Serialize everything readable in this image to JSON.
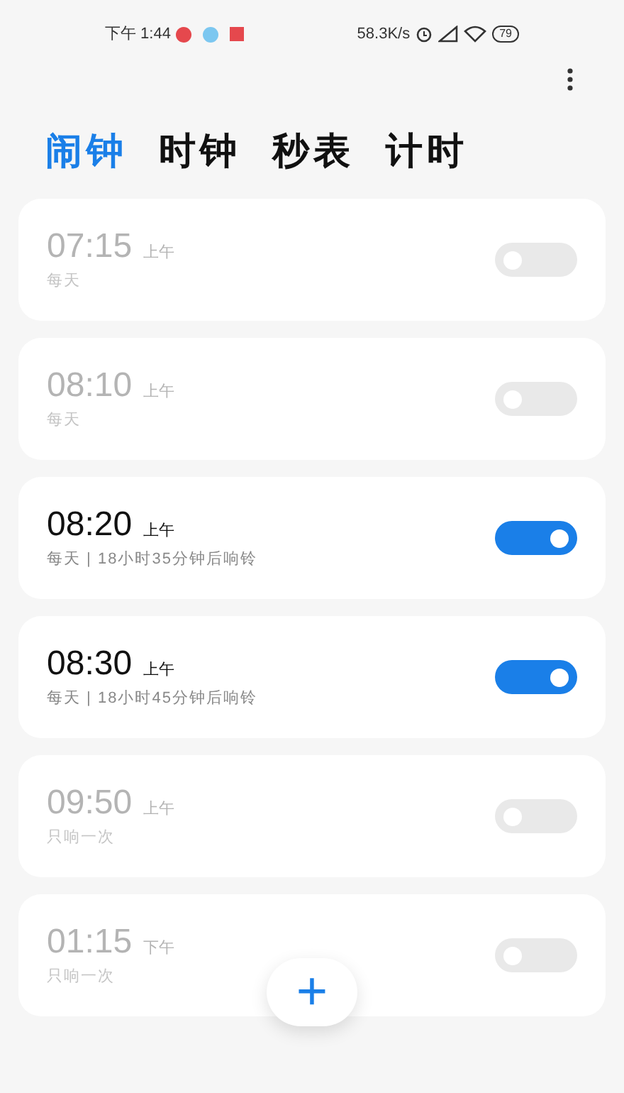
{
  "status_bar": {
    "time": "下午 1:44",
    "speed": "58.3K/s",
    "battery": "79"
  },
  "tabs": [
    {
      "label": "闹钟",
      "selected": true
    },
    {
      "label": "时钟",
      "selected": false
    },
    {
      "label": "秒表",
      "selected": false
    },
    {
      "label": "计时",
      "selected": false
    }
  ],
  "alarms": [
    {
      "time": "07:15",
      "period": "上午",
      "detail": "每天",
      "on": false
    },
    {
      "time": "08:10",
      "period": "上午",
      "detail": "每天",
      "on": false
    },
    {
      "time": "08:20",
      "period": "上午",
      "detail": "每天 | 18小时35分钟后响铃",
      "on": true
    },
    {
      "time": "08:30",
      "period": "上午",
      "detail": "每天 | 18小时45分钟后响铃",
      "on": true
    },
    {
      "time": "09:50",
      "period": "上午",
      "detail": "只响一次",
      "on": false
    },
    {
      "time": "01:15",
      "period": "下午",
      "detail": "只响一次",
      "on": false
    }
  ],
  "add_button": "+"
}
